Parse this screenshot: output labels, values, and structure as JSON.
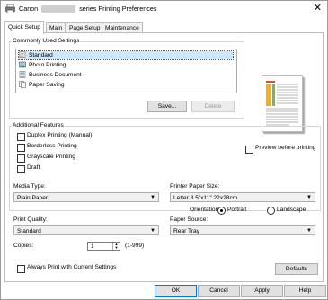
{
  "window": {
    "title_prefix": "Canon",
    "title_suffix": "series Printing Preferences",
    "close_label": "✕"
  },
  "tabs": [
    {
      "label": "Quick Setup",
      "active": true
    },
    {
      "label": "Main",
      "active": false
    },
    {
      "label": "Page Setup",
      "active": false
    },
    {
      "label": "Maintenance",
      "active": false
    }
  ],
  "commonly_used": {
    "title": "Commonly Used Settings",
    "items": [
      {
        "label": "Standard",
        "icon": "standard-icon",
        "selected": true
      },
      {
        "label": "Photo Printing",
        "icon": "photo-icon",
        "selected": false
      },
      {
        "label": "Business Document",
        "icon": "document-icon",
        "selected": false
      },
      {
        "label": "Paper Saving",
        "icon": "paper-saving-icon",
        "selected": false
      }
    ],
    "save_label": "Save...",
    "delete_label": "Delete"
  },
  "preview": {
    "label": "Preview before printing",
    "checked": false
  },
  "additional": {
    "title": "Additional Features",
    "items": [
      {
        "label": "Duplex Printing (Manual)",
        "checked": false
      },
      {
        "label": "Borderless Printing",
        "checked": false
      },
      {
        "label": "Grayscale Printing",
        "checked": false
      },
      {
        "label": "Draft",
        "checked": false
      }
    ]
  },
  "media_type": {
    "label": "Media Type:",
    "value": "Plain Paper"
  },
  "paper_size": {
    "label": "Printer Paper Size:",
    "value": "Letter 8.5\"x11\" 22x28cm"
  },
  "orientation": {
    "label": "Orientation:",
    "portrait": "Portrait",
    "landscape": "Landscape",
    "selected": "Portrait"
  },
  "print_quality": {
    "label": "Print Quality:",
    "value": "Standard"
  },
  "paper_source": {
    "label": "Paper Source:",
    "value": "Rear Tray"
  },
  "copies": {
    "label": "Copies:",
    "value": "1",
    "range": "(1-999)"
  },
  "always_print": {
    "label": "Always Print with Current Settings",
    "checked": false
  },
  "defaults_label": "Defaults",
  "buttons": {
    "ok": "OK",
    "cancel": "Cancel",
    "apply": "Apply",
    "help": "Help"
  },
  "colors": {
    "selection": "#cce8ff",
    "selection_border": "#99d1ff",
    "focus": "#0078d7"
  }
}
